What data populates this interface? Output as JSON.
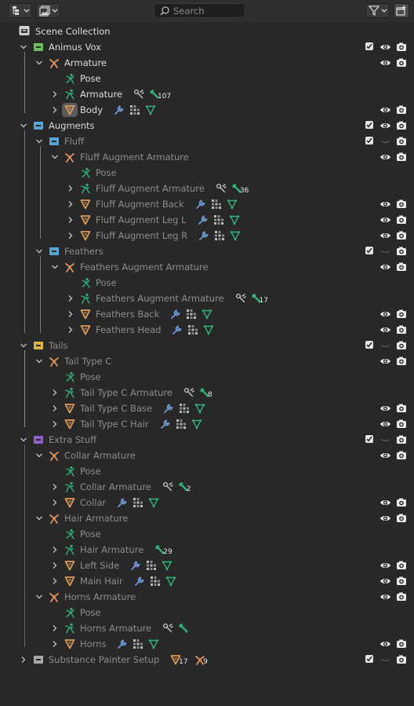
{
  "header": {
    "search_placeholder": "Search"
  },
  "colors": {
    "armature": "#e0925a",
    "bone": "#2fb37a",
    "mesh": "#e09b5a",
    "modifier": "#6e9cd9",
    "col_green": "#6abf58",
    "col_blue": "#5aa3d6",
    "col_yellow": "#d8b544",
    "col_purple": "#8d62c6",
    "col_grey": "#a8a8a8"
  },
  "rows": [
    {
      "label": "Scene Collection",
      "depth": 0,
      "icon": "scene-collection-icon",
      "chevron": "none",
      "check": false,
      "eye": false,
      "cam": false,
      "extras": []
    },
    {
      "label": "Animus Vox",
      "depth": 1,
      "icon": "collection-icon-green",
      "chevron": "open",
      "check": true,
      "eye": "on",
      "cam": true,
      "extras": []
    },
    {
      "label": "Armature",
      "depth": 2,
      "icon": "armature-object-icon",
      "chevron": "open",
      "check": false,
      "eye": "on",
      "cam": true,
      "extras": []
    },
    {
      "label": "Pose",
      "depth": 3,
      "icon": "pose-icon",
      "chevron": "none",
      "check": false,
      "eye": false,
      "cam": false,
      "extras": []
    },
    {
      "label": "Armature",
      "depth": 3,
      "icon": "armature-data-icon",
      "chevron": "closed",
      "check": false,
      "eye": false,
      "cam": false,
      "extras": [
        {
          "icon": "bone-constraint-icon"
        },
        {
          "icon": "bone-icon",
          "badge": "107"
        }
      ]
    },
    {
      "label": "Body",
      "depth": 3,
      "icon": "mesh-object-icon",
      "chevron": "closed",
      "check": false,
      "eye": "on",
      "cam": true,
      "selected": true,
      "extras": [
        {
          "icon": "modifier-wrench-icon"
        },
        {
          "icon": "vertex-groups-icon"
        },
        {
          "icon": "mesh-data-icon"
        }
      ]
    },
    {
      "label": "Augments",
      "depth": 1,
      "icon": "collection-icon-blue",
      "chevron": "open",
      "check": true,
      "eye": "on",
      "cam": true,
      "extras": []
    },
    {
      "label": "Fluff",
      "depth": 2,
      "icon": "collection-icon-blue",
      "chevron": "open",
      "check": true,
      "eye": "off",
      "cam": true,
      "dim": true,
      "extras": []
    },
    {
      "label": "Fluff Augment Armature",
      "depth": 3,
      "icon": "armature-object-icon",
      "chevron": "open",
      "check": false,
      "eye": "on",
      "cam": true,
      "dim": true,
      "extras": []
    },
    {
      "label": "Pose",
      "depth": 4,
      "icon": "pose-icon",
      "chevron": "none",
      "check": false,
      "eye": false,
      "cam": false,
      "dim": true,
      "extras": []
    },
    {
      "label": "Fluff Augment Armature",
      "depth": 4,
      "icon": "armature-data-icon",
      "chevron": "closed",
      "check": false,
      "eye": false,
      "cam": false,
      "dim": true,
      "extras": [
        {
          "icon": "bone-constraint-icon"
        },
        {
          "icon": "bone-icon",
          "badge": "36"
        }
      ]
    },
    {
      "label": "Fluff Augment Back",
      "depth": 4,
      "icon": "mesh-object-icon",
      "chevron": "closed",
      "check": false,
      "eye": "on",
      "cam": true,
      "dim": true,
      "extras": [
        {
          "icon": "modifier-wrench-icon"
        },
        {
          "icon": "vertex-groups-icon"
        },
        {
          "icon": "mesh-data-icon"
        }
      ]
    },
    {
      "label": "Fluff Augment Leg L",
      "depth": 4,
      "icon": "mesh-object-icon",
      "chevron": "closed",
      "check": false,
      "eye": "on",
      "cam": true,
      "dim": true,
      "extras": [
        {
          "icon": "modifier-wrench-icon"
        },
        {
          "icon": "vertex-groups-icon"
        },
        {
          "icon": "mesh-data-icon"
        }
      ]
    },
    {
      "label": "Fluff Augment Leg R",
      "depth": 4,
      "icon": "mesh-object-icon",
      "chevron": "closed",
      "check": false,
      "eye": "on",
      "cam": true,
      "dim": true,
      "extras": [
        {
          "icon": "modifier-wrench-icon"
        },
        {
          "icon": "vertex-groups-icon"
        },
        {
          "icon": "mesh-data-icon"
        }
      ]
    },
    {
      "label": "Feathers",
      "depth": 2,
      "icon": "collection-icon-blue",
      "chevron": "open",
      "check": true,
      "eye": "off",
      "cam": true,
      "dim": true,
      "extras": []
    },
    {
      "label": "Feathers Augment Armature",
      "depth": 3,
      "icon": "armature-object-icon",
      "chevron": "open",
      "check": false,
      "eye": "on",
      "cam": true,
      "dim": true,
      "extras": []
    },
    {
      "label": "Pose",
      "depth": 4,
      "icon": "pose-icon",
      "chevron": "none",
      "check": false,
      "eye": false,
      "cam": false,
      "dim": true,
      "extras": []
    },
    {
      "label": "Feathers Augment Armature",
      "depth": 4,
      "icon": "armature-data-icon",
      "chevron": "closed",
      "check": false,
      "eye": false,
      "cam": false,
      "dim": true,
      "extras": [
        {
          "icon": "bone-constraint-icon"
        },
        {
          "icon": "bone-icon",
          "badge": "17"
        }
      ]
    },
    {
      "label": "Feathers Back",
      "depth": 4,
      "icon": "mesh-object-icon",
      "chevron": "closed",
      "check": false,
      "eye": "on",
      "cam": true,
      "dim": true,
      "extras": [
        {
          "icon": "modifier-wrench-icon"
        },
        {
          "icon": "vertex-groups-icon"
        },
        {
          "icon": "mesh-data-icon"
        }
      ]
    },
    {
      "label": "Feathers Head",
      "depth": 4,
      "icon": "mesh-object-icon",
      "chevron": "closed",
      "check": false,
      "eye": "on",
      "cam": true,
      "dim": true,
      "extras": [
        {
          "icon": "modifier-wrench-icon"
        },
        {
          "icon": "vertex-groups-icon"
        },
        {
          "icon": "mesh-data-icon"
        }
      ]
    },
    {
      "label": "Tails",
      "depth": 1,
      "icon": "collection-icon-yellow",
      "chevron": "open",
      "check": true,
      "eye": "off",
      "cam": true,
      "dim": true,
      "extras": []
    },
    {
      "label": "Tail Type C",
      "depth": 2,
      "icon": "armature-object-icon",
      "chevron": "open",
      "check": false,
      "eye": "on",
      "cam": true,
      "dim": true,
      "extras": []
    },
    {
      "label": "Pose",
      "depth": 3,
      "icon": "pose-icon",
      "chevron": "none",
      "check": false,
      "eye": false,
      "cam": false,
      "dim": true,
      "extras": []
    },
    {
      "label": "Tail Type C Armature",
      "depth": 3,
      "icon": "armature-data-icon",
      "chevron": "closed",
      "check": false,
      "eye": false,
      "cam": false,
      "dim": true,
      "extras": [
        {
          "icon": "bone-constraint-icon"
        },
        {
          "icon": "bone-icon",
          "badge": "8"
        }
      ]
    },
    {
      "label": "Tail Type C Base",
      "depth": 3,
      "icon": "mesh-object-icon",
      "chevron": "closed",
      "check": false,
      "eye": "on",
      "cam": true,
      "dim": true,
      "extras": [
        {
          "icon": "modifier-wrench-icon"
        },
        {
          "icon": "vertex-groups-icon"
        },
        {
          "icon": "mesh-data-icon"
        }
      ]
    },
    {
      "label": "Tail Type C Hair",
      "depth": 3,
      "icon": "mesh-object-icon",
      "chevron": "closed",
      "check": false,
      "eye": "on",
      "cam": true,
      "dim": true,
      "extras": [
        {
          "icon": "modifier-wrench-icon"
        },
        {
          "icon": "vertex-groups-icon"
        },
        {
          "icon": "mesh-data-icon"
        }
      ]
    },
    {
      "label": "Extra Stuff",
      "depth": 1,
      "icon": "collection-icon-purple",
      "chevron": "open",
      "check": true,
      "eye": "off",
      "cam": true,
      "dim": true,
      "extras": []
    },
    {
      "label": "Collar Armature",
      "depth": 2,
      "icon": "armature-object-icon",
      "chevron": "open",
      "check": false,
      "eye": "on",
      "cam": true,
      "dim": true,
      "extras": []
    },
    {
      "label": "Pose",
      "depth": 3,
      "icon": "pose-icon",
      "chevron": "none",
      "check": false,
      "eye": false,
      "cam": false,
      "dim": true,
      "extras": []
    },
    {
      "label": "Collar Armature",
      "depth": 3,
      "icon": "armature-data-icon",
      "chevron": "closed",
      "check": false,
      "eye": false,
      "cam": false,
      "dim": true,
      "extras": [
        {
          "icon": "bone-constraint-icon"
        },
        {
          "icon": "bone-icon",
          "badge": "2"
        }
      ]
    },
    {
      "label": "Collar",
      "depth": 3,
      "icon": "mesh-object-icon",
      "chevron": "closed",
      "check": false,
      "eye": "on",
      "cam": true,
      "dim": true,
      "extras": [
        {
          "icon": "modifier-wrench-icon"
        },
        {
          "icon": "vertex-groups-icon"
        },
        {
          "icon": "mesh-data-icon"
        }
      ]
    },
    {
      "label": "Hair Armature",
      "depth": 2,
      "icon": "armature-object-icon",
      "chevron": "open",
      "check": false,
      "eye": "on",
      "cam": true,
      "dim": true,
      "extras": []
    },
    {
      "label": "Pose",
      "depth": 3,
      "icon": "pose-icon",
      "chevron": "none",
      "check": false,
      "eye": false,
      "cam": false,
      "dim": true,
      "extras": []
    },
    {
      "label": "Hair Armature",
      "depth": 3,
      "icon": "armature-data-icon",
      "chevron": "closed",
      "check": false,
      "eye": false,
      "cam": false,
      "dim": true,
      "extras": [
        {
          "icon": "bone-icon",
          "badge": "29"
        }
      ]
    },
    {
      "label": "Left Side",
      "depth": 3,
      "icon": "mesh-object-icon",
      "chevron": "closed",
      "check": false,
      "eye": "on",
      "cam": true,
      "dim": true,
      "extras": [
        {
          "icon": "modifier-wrench-icon"
        },
        {
          "icon": "vertex-groups-icon"
        },
        {
          "icon": "mesh-data-icon"
        }
      ]
    },
    {
      "label": "Main Hair",
      "depth": 3,
      "icon": "mesh-object-icon",
      "chevron": "closed",
      "check": false,
      "eye": "on",
      "cam": true,
      "dim": true,
      "extras": [
        {
          "icon": "modifier-wrench-icon"
        },
        {
          "icon": "vertex-groups-icon"
        },
        {
          "icon": "mesh-data-icon"
        }
      ]
    },
    {
      "label": "Horns Armature",
      "depth": 2,
      "icon": "armature-object-icon",
      "chevron": "open",
      "check": false,
      "eye": "on",
      "cam": true,
      "dim": true,
      "extras": []
    },
    {
      "label": "Pose",
      "depth": 3,
      "icon": "pose-icon",
      "chevron": "none",
      "check": false,
      "eye": false,
      "cam": false,
      "dim": true,
      "extras": []
    },
    {
      "label": "Horns Armature",
      "depth": 3,
      "icon": "armature-data-icon",
      "chevron": "closed",
      "check": false,
      "eye": false,
      "cam": false,
      "dim": true,
      "extras": [
        {
          "icon": "bone-constraint-icon"
        },
        {
          "icon": "bone-icon"
        }
      ]
    },
    {
      "label": "Horns",
      "depth": 3,
      "icon": "mesh-object-icon",
      "chevron": "closed",
      "check": false,
      "eye": "on",
      "cam": true,
      "dim": true,
      "extras": [
        {
          "icon": "modifier-wrench-icon"
        },
        {
          "icon": "vertex-groups-icon"
        },
        {
          "icon": "mesh-data-icon"
        }
      ]
    },
    {
      "label": "Substance Painter Setup",
      "depth": 1,
      "icon": "collection-icon-grey",
      "chevron": "closed",
      "check": true,
      "eye": "off",
      "cam": true,
      "dim": true,
      "extras": [
        {
          "icon": "mesh-object-icon",
          "badge": "17"
        },
        {
          "icon": "armature-object-icon",
          "badge": "9"
        }
      ]
    }
  ]
}
